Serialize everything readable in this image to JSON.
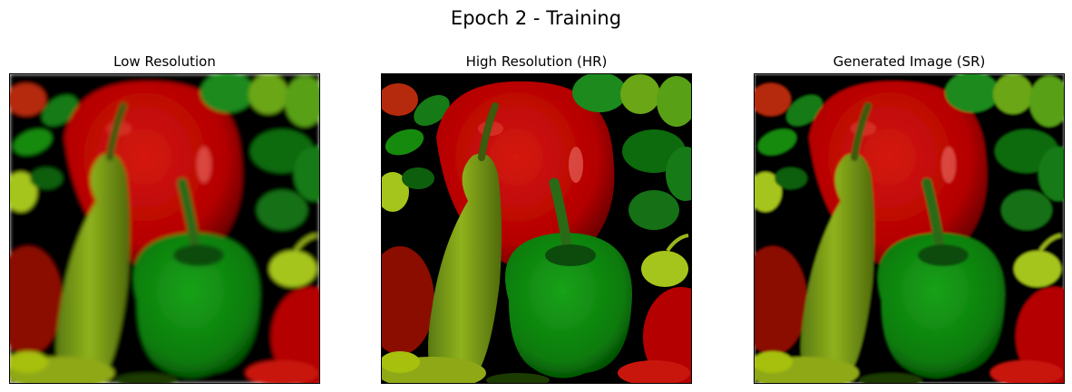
{
  "figure": {
    "title": "Epoch 2 - Training"
  },
  "panels": [
    {
      "title": "Low Resolution",
      "image": "peppers-photo",
      "quality": "soft"
    },
    {
      "title": "High Resolution (HR)",
      "image": "peppers-photo",
      "quality": "sharp"
    },
    {
      "title": "Generated Image (SR)",
      "image": "peppers-photo",
      "quality": "medium"
    }
  ],
  "colors": {
    "background": "#000000",
    "red_pepper": "#b40000",
    "green_pepper": "#0a7a0a",
    "yellow_green_pepper": "#8fb21c",
    "lime": "#a6c51a"
  }
}
